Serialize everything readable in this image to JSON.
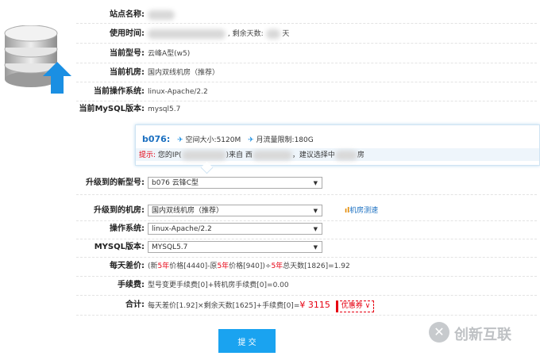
{
  "info": {
    "site_name_label": "站点名称:",
    "usage_time_label": "使用时间:",
    "usage_time_suffix": ", 剩余天数:",
    "usage_time_end": "天",
    "current_model_label": "当前型号:",
    "current_model_value": "云峰A型(w5)",
    "current_room_label": "当前机房:",
    "current_room_value": "国内双线机房（推荐）",
    "current_os_label": "当前操作系统:",
    "current_os_value": "linux-Apache/2.2",
    "current_mysql_label": "当前MySQL版本:",
    "current_mysql_value": "mysql5.7"
  },
  "card": {
    "code": "b076:",
    "space": "空间大小:5120M",
    "traffic": "月流量限制:180G",
    "tip_label": "提示:",
    "tip_text_1": "您的IP(",
    "tip_text_2": ")来自 西",
    "tip_text_3": "，建议选择中",
    "tip_text_4": "房"
  },
  "form": {
    "new_model_label": "升级到的新型号:",
    "new_model_value": "b076 云锋C型",
    "new_room_label": "升级到的机房:",
    "new_room_value": "国内双线机房（推荐）",
    "speed_test_link": "机房测速",
    "os_label": "操作系统:",
    "os_value": "linux-Apache/2.2",
    "mysql_label": "MYSQL版本:",
    "mysql_value": "MYSQL5.7",
    "daily_diff_label": "每天差价:",
    "daily_diff_p1": "(新",
    "daily_diff_p2": "5年",
    "daily_diff_p3": "价格[4440]-原",
    "daily_diff_p4": "5年",
    "daily_diff_p5": "价格[940])÷",
    "daily_diff_p6": "5年",
    "daily_diff_p7": "总天数[1826]=1.92",
    "fee_label": "手续费:",
    "fee_value": "型号变更手续费[0]+转机房手续费[0]=0.00",
    "total_label": "合计:",
    "total_formula": "每天差价[1.92]×剩余天数[1625]+手续费[0]=",
    "total_amount": "¥ 3115",
    "coupon_label": "优惠券 ∨",
    "submit_label": "提 交"
  },
  "watermark": "创新互联",
  "colors": {
    "accent": "#1aa3f0",
    "red": "#e60012",
    "card_title": "#1a6fc0"
  }
}
